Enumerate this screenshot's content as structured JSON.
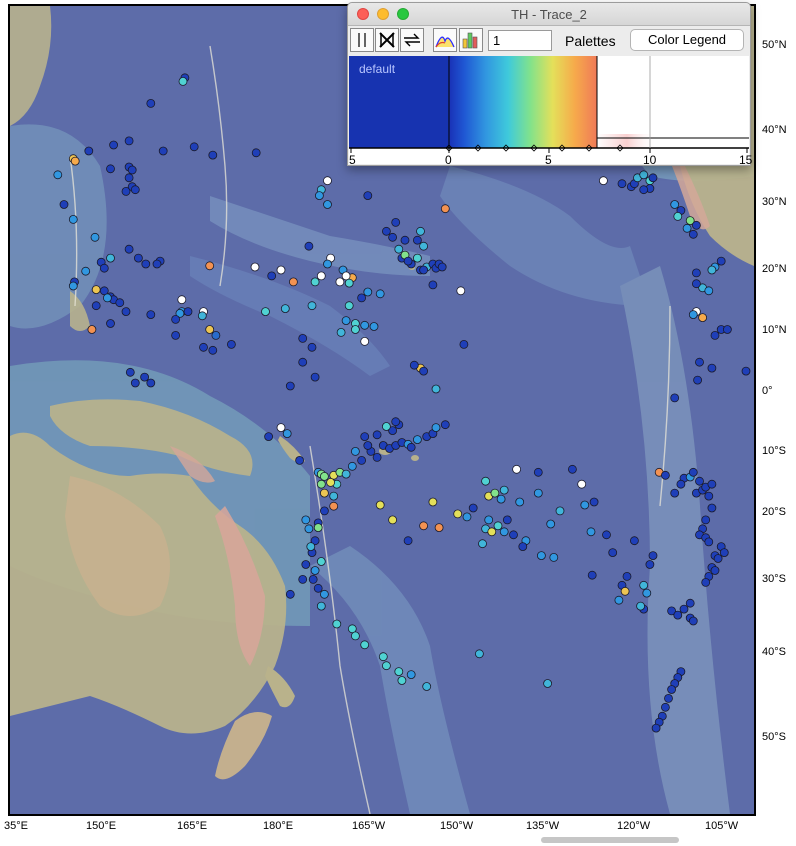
{
  "window": {
    "title": "TH - Trace_2",
    "level_value": "1",
    "palettes_label": "Palettes",
    "color_legend_label": "Color Legend",
    "palette_name": "default",
    "palette_ticks": [
      "5",
      "0",
      "5",
      "10",
      "15"
    ]
  },
  "map": {
    "lat_labels": [
      "50°N",
      "40°N",
      "30°N",
      "20°N",
      "10°N",
      "0°",
      "10°S",
      "20°S",
      "30°S",
      "40°S",
      "50°S"
    ],
    "lon_labels": [
      "35°E",
      "150°E",
      "165°E",
      "180°E",
      "165°W",
      "150°W",
      "135°W",
      "120°W",
      "105°W"
    ],
    "colors": {
      "ocean_deep": "#5d6ca9",
      "ocean_shelf": "#7fb6c2",
      "land": "#b9b28a",
      "land_high": "#d9a99a"
    }
  },
  "chart_data": {
    "type": "scatter",
    "xlim": [
      135,
      255
    ],
    "ylim": [
      -60,
      55
    ],
    "color_scale": {
      "min": -5,
      "max": 15
    },
    "points": [
      [
        164.5,
        51.8,
        0
      ],
      [
        164.2,
        51.2,
        4
      ],
      [
        159,
        47.5,
        0
      ],
      [
        146.5,
        38.2,
        8
      ],
      [
        146.8,
        37.8,
        9
      ],
      [
        144,
        35.5,
        2
      ],
      [
        149,
        39.5,
        0
      ],
      [
        153,
        40.5,
        0
      ],
      [
        155.5,
        41.2,
        0
      ],
      [
        161,
        39.5,
        0
      ],
      [
        166,
        40.2,
        0
      ],
      [
        169,
        38.8,
        0
      ],
      [
        176,
        39.2,
        0
      ],
      [
        152.5,
        36.5,
        0
      ],
      [
        155.5,
        36.8,
        0
      ],
      [
        156,
        36.3,
        0
      ],
      [
        155.5,
        35,
        0
      ],
      [
        156,
        33.5,
        0
      ],
      [
        156.5,
        33,
        0
      ],
      [
        155,
        32.7,
        0
      ],
      [
        145,
        30.5,
        0
      ],
      [
        146.5,
        28,
        2
      ],
      [
        150,
        25,
        2
      ],
      [
        155.5,
        23,
        0
      ],
      [
        157,
        21.5,
        0
      ],
      [
        160.5,
        21,
        0
      ],
      [
        160,
        20.5,
        0
      ],
      [
        158.2,
        20.5,
        0
      ],
      [
        151,
        20.8,
        0
      ],
      [
        152.5,
        21.5,
        3
      ],
      [
        151.5,
        19.8,
        0
      ],
      [
        148.5,
        19.3,
        2
      ],
      [
        146.7,
        17.5,
        0
      ],
      [
        146.5,
        16.8,
        2
      ],
      [
        150.2,
        16.2,
        8
      ],
      [
        151.5,
        16,
        0
      ],
      [
        152.5,
        15,
        0
      ],
      [
        153,
        14.5,
        0
      ],
      [
        154,
        14,
        0
      ],
      [
        152,
        14.8,
        2
      ],
      [
        150.2,
        13.5,
        0
      ],
      [
        155,
        12.5,
        0
      ],
      [
        159,
        12,
        0
      ],
      [
        164,
        12.5,
        2
      ],
      [
        163.7,
        12.2,
        2
      ],
      [
        165,
        12.5,
        0
      ],
      [
        163,
        11.2,
        0
      ],
      [
        167.5,
        12.5,
        15
      ],
      [
        167.3,
        11.8,
        3
      ],
      [
        168.5,
        9.5,
        8
      ],
      [
        169.5,
        8.5,
        1
      ],
      [
        172,
        7,
        0
      ],
      [
        163,
        8.5,
        0
      ],
      [
        167.5,
        6.5,
        0
      ],
      [
        169,
        6,
        0
      ],
      [
        149.5,
        9.5,
        10
      ],
      [
        152.5,
        10.5,
        0
      ],
      [
        155.7,
        2.3,
        0
      ],
      [
        158,
        1.5,
        0
      ],
      [
        159,
        0.5,
        0
      ],
      [
        156.5,
        0.5,
        0
      ],
      [
        164,
        14.5,
        15
      ],
      [
        168.5,
        20.2,
        10
      ],
      [
        177.5,
        12.5,
        4
      ],
      [
        180.7,
        13,
        3
      ],
      [
        185.5,
        17.5,
        4
      ],
      [
        186.5,
        18.5,
        15
      ],
      [
        182,
        17.5,
        10
      ],
      [
        178.5,
        18.5,
        0
      ],
      [
        180,
        19.5,
        15
      ],
      [
        175.8,
        20,
        15
      ],
      [
        184.5,
        23.5,
        0
      ],
      [
        188,
        21.5,
        15
      ],
      [
        187.5,
        20.5,
        2
      ],
      [
        190,
        19.5,
        2
      ],
      [
        191.5,
        18.2,
        9
      ],
      [
        189.5,
        17.5,
        15
      ],
      [
        190.5,
        18.5,
        15
      ],
      [
        191,
        17.3,
        4
      ],
      [
        194,
        15.8,
        2
      ],
      [
        193,
        14.8,
        0
      ],
      [
        196,
        15.5,
        2
      ],
      [
        191,
        13.5,
        4
      ],
      [
        190.5,
        11,
        2
      ],
      [
        192,
        10.5,
        4
      ],
      [
        193.5,
        10.2,
        2
      ],
      [
        192,
        9.5,
        4
      ],
      [
        195,
        10,
        2
      ],
      [
        193.5,
        7.5,
        15
      ],
      [
        189.7,
        9,
        3
      ],
      [
        185,
        13.5,
        3
      ],
      [
        183.5,
        8,
        0
      ],
      [
        185,
        6.5,
        0
      ],
      [
        183.5,
        4,
        0
      ],
      [
        181.5,
        0,
        0
      ],
      [
        185.5,
        1.5,
        0
      ],
      [
        187.5,
        30.5,
        2
      ],
      [
        186.5,
        33,
        3
      ],
      [
        186.2,
        32,
        2
      ],
      [
        187.5,
        34.5,
        15
      ],
      [
        194,
        32,
        0
      ],
      [
        197,
        26,
        0
      ],
      [
        198,
        25,
        0
      ],
      [
        200,
        24.5,
        0
      ],
      [
        199,
        23,
        3
      ],
      [
        199.5,
        21.5,
        0
      ],
      [
        202,
        21.5,
        4
      ],
      [
        201,
        20.5,
        0
      ],
      [
        202.5,
        19.5,
        0
      ],
      [
        203.5,
        20,
        3
      ],
      [
        204.5,
        20.5,
        0
      ],
      [
        205,
        19.8,
        0
      ],
      [
        205.5,
        20.5,
        0
      ],
      [
        206,
        20,
        0
      ],
      [
        200,
        22,
        5
      ],
      [
        200.5,
        21,
        0
      ],
      [
        203,
        19.5,
        0
      ],
      [
        202,
        24.5,
        0
      ],
      [
        203,
        23.5,
        3
      ],
      [
        202.5,
        26,
        3
      ],
      [
        204.5,
        17,
        0
      ],
      [
        209,
        16,
        15
      ],
      [
        209.5,
        7,
        0
      ],
      [
        202.5,
        3,
        8
      ],
      [
        201.5,
        3.5,
        0
      ],
      [
        203,
        2.5,
        0
      ],
      [
        205,
        -0.5,
        3
      ],
      [
        198.5,
        27.5,
        0
      ],
      [
        206.5,
        29.8,
        10
      ],
      [
        180,
        -7,
        15
      ],
      [
        181,
        -8,
        2
      ],
      [
        178,
        -8.5,
        0
      ],
      [
        183,
        -12.5,
        0
      ],
      [
        186,
        -14.5,
        2
      ],
      [
        186.5,
        -14.8,
        5
      ],
      [
        187,
        -15.2,
        5
      ],
      [
        188.5,
        -15,
        7
      ],
      [
        189.5,
        -14.5,
        5
      ],
      [
        190.5,
        -14.8,
        3
      ],
      [
        191.5,
        -13.5,
        2
      ],
      [
        193,
        -12.5,
        0
      ],
      [
        194.5,
        -11,
        0
      ],
      [
        193.5,
        -8.5,
        0
      ],
      [
        195.5,
        -8.2,
        0
      ],
      [
        196.5,
        -10,
        0
      ],
      [
        197.5,
        -10.5,
        0
      ],
      [
        198.5,
        -10,
        0
      ],
      [
        199.5,
        -9.5,
        0
      ],
      [
        200.5,
        -9.8,
        2
      ],
      [
        201,
        -10.3,
        0
      ],
      [
        202,
        -9,
        2
      ],
      [
        203.5,
        -8.5,
        0
      ],
      [
        204.5,
        -8,
        0
      ],
      [
        205,
        -7,
        2
      ],
      [
        206.5,
        -6.5,
        0
      ],
      [
        199,
        -6.5,
        0
      ],
      [
        198.5,
        -6,
        0
      ],
      [
        198,
        -7.5,
        0
      ],
      [
        197,
        -6.8,
        4
      ],
      [
        194,
        -10,
        0
      ],
      [
        195.5,
        -12,
        0
      ],
      [
        192,
        -11,
        2
      ],
      [
        186.5,
        -16.5,
        5
      ],
      [
        187,
        -18,
        8
      ],
      [
        189,
        -16.5,
        4
      ],
      [
        188.5,
        -18.5,
        3
      ],
      [
        187,
        -21,
        0
      ],
      [
        186,
        -23,
        0
      ],
      [
        185.5,
        -26,
        0
      ],
      [
        185,
        -28,
        0
      ],
      [
        186.5,
        -29.5,
        4
      ],
      [
        185.5,
        -31,
        2
      ],
      [
        185.2,
        -32.5,
        0
      ],
      [
        186,
        -34,
        0
      ],
      [
        187,
        -35,
        2
      ],
      [
        186.5,
        -37,
        3
      ],
      [
        189,
        -40,
        4
      ],
      [
        191.5,
        -40.8,
        4
      ],
      [
        192,
        -42,
        4
      ],
      [
        193.5,
        -43.5,
        4
      ],
      [
        196.5,
        -45.5,
        4
      ],
      [
        197,
        -47,
        4
      ],
      [
        199,
        -48,
        4
      ],
      [
        199.5,
        -49.5,
        4
      ],
      [
        201,
        -48.5,
        2
      ],
      [
        203.5,
        -50.5,
        3
      ],
      [
        184.5,
        -24,
        2
      ],
      [
        184,
        -22.5,
        2
      ],
      [
        184.8,
        -27,
        3
      ],
      [
        184,
        -30,
        0
      ],
      [
        183.5,
        -32.5,
        0
      ],
      [
        181.5,
        -35,
        0
      ],
      [
        186,
        -23.8,
        5
      ],
      [
        188.5,
        -20.2,
        10
      ],
      [
        188,
        -16.2,
        7
      ],
      [
        196,
        -20,
        7
      ],
      [
        198,
        -22.5,
        7
      ],
      [
        200.5,
        -26,
        0
      ],
      [
        203,
        -23.5,
        10
      ],
      [
        205.5,
        -23.8,
        10
      ],
      [
        204.5,
        -19.5,
        7
      ],
      [
        210,
        -22,
        2
      ],
      [
        208.5,
        -21.5,
        7
      ],
      [
        211,
        -20.5,
        0
      ],
      [
        213.5,
        -22.5,
        2
      ],
      [
        213,
        -24,
        3
      ],
      [
        214,
        -24.5,
        7
      ],
      [
        215,
        -23.5,
        4
      ],
      [
        216,
        -24.5,
        2
      ],
      [
        216.5,
        -22.5,
        0
      ],
      [
        217.5,
        -25,
        0
      ],
      [
        219.5,
        -26,
        2
      ],
      [
        219,
        -27,
        0
      ],
      [
        222,
        -28.5,
        2
      ],
      [
        224,
        -28.8,
        2
      ],
      [
        212.5,
        -26.5,
        3
      ],
      [
        213.5,
        -18.5,
        7
      ],
      [
        214.5,
        -18,
        5
      ],
      [
        216,
        -17.5,
        3
      ],
      [
        215.5,
        -19,
        2
      ],
      [
        218.5,
        -19.5,
        2
      ],
      [
        221.5,
        -18,
        2
      ],
      [
        213,
        -16,
        4
      ],
      [
        218,
        -14,
        15
      ],
      [
        221.5,
        -14.5,
        0
      ],
      [
        227,
        -14,
        0
      ],
      [
        228.5,
        -16.5,
        15
      ],
      [
        225,
        -21,
        3
      ],
      [
        229,
        -20,
        2
      ],
      [
        230.5,
        -19.5,
        0
      ],
      [
        223.5,
        -23.2,
        2
      ],
      [
        230,
        -24.5,
        2
      ],
      [
        232.5,
        -25,
        0
      ],
      [
        237,
        -26,
        0
      ],
      [
        233.5,
        -28,
        0
      ],
      [
        240,
        -28.5,
        0
      ],
      [
        239.5,
        -30,
        0
      ],
      [
        230.2,
        -31.8,
        0
      ],
      [
        235.8,
        -32,
        0
      ],
      [
        235,
        -33.5,
        0
      ],
      [
        235.5,
        -34.5,
        8
      ],
      [
        238.5,
        -33.5,
        3
      ],
      [
        239,
        -34.8,
        2
      ],
      [
        234.5,
        -36,
        2
      ],
      [
        238.5,
        -37.5,
        0
      ],
      [
        238,
        -37,
        3
      ],
      [
        246,
        -36.5,
        0
      ],
      [
        245,
        -37.5,
        0
      ],
      [
        243,
        -37.8,
        0
      ],
      [
        244,
        -38.5,
        0
      ],
      [
        246,
        -39,
        0
      ],
      [
        246.5,
        -39.5,
        0
      ],
      [
        241,
        -14.5,
        10
      ],
      [
        242,
        -15,
        0
      ],
      [
        245,
        -15.5,
        0
      ],
      [
        244.5,
        -16.5,
        0
      ],
      [
        243.5,
        -18,
        0
      ],
      [
        246,
        -15.3,
        2
      ],
      [
        246.5,
        -14.5,
        0
      ],
      [
        247.5,
        -16,
        0
      ],
      [
        247,
        -18,
        0
      ],
      [
        248,
        -17.5,
        0
      ],
      [
        248.5,
        -17,
        0
      ],
      [
        249.5,
        -16.5,
        0
      ],
      [
        249,
        -18.5,
        0
      ],
      [
        249.5,
        -20.5,
        0
      ],
      [
        248.5,
        -22.5,
        0
      ],
      [
        248,
        -24,
        0
      ],
      [
        247.5,
        -25,
        0
      ],
      [
        248.5,
        -25.5,
        0
      ],
      [
        249,
        -26.2,
        0
      ],
      [
        251,
        -27,
        0
      ],
      [
        251.5,
        -28,
        0
      ],
      [
        250,
        -28.5,
        0
      ],
      [
        250.5,
        -29,
        0
      ],
      [
        249.5,
        -30.5,
        0
      ],
      [
        250,
        -31,
        0
      ],
      [
        249,
        -32,
        0
      ],
      [
        248.5,
        -33,
        0
      ],
      [
        243.5,
        -2,
        0
      ],
      [
        251,
        9.5,
        0
      ],
      [
        252,
        9.5,
        0
      ],
      [
        250,
        8.5,
        0
      ],
      [
        247,
        12.5,
        15
      ],
      [
        248,
        11.5,
        9
      ],
      [
        246.5,
        12,
        2
      ],
      [
        247.5,
        4,
        0
      ],
      [
        247.2,
        1,
        0
      ],
      [
        249.5,
        3,
        0
      ],
      [
        255,
        2.5,
        0
      ],
      [
        251,
        21,
        0
      ],
      [
        250,
        20,
        2
      ],
      [
        249.5,
        19.5,
        3
      ],
      [
        247,
        19,
        0
      ],
      [
        248,
        16.5,
        3
      ],
      [
        247,
        17.2,
        0
      ],
      [
        249,
        16,
        2
      ],
      [
        232,
        34.5,
        15
      ],
      [
        235,
        34,
        0
      ],
      [
        236.5,
        33.5,
        0
      ],
      [
        237,
        34,
        0
      ],
      [
        237.5,
        35,
        3
      ],
      [
        238.5,
        35.5,
        3
      ],
      [
        239.5,
        34.5,
        4
      ],
      [
        240,
        35,
        0
      ],
      [
        239.5,
        33.2,
        0
      ],
      [
        238.5,
        33,
        0
      ],
      [
        243.5,
        30.5,
        2
      ],
      [
        244.5,
        29.5,
        0
      ],
      [
        244,
        28.5,
        4
      ],
      [
        245.5,
        26.5,
        2
      ],
      [
        246.5,
        25.5,
        0
      ],
      [
        246,
        27.8,
        5
      ],
      [
        247,
        27,
        0
      ],
      [
        244.5,
        -48,
        0
      ],
      [
        244,
        -49,
        0
      ],
      [
        243.5,
        -50,
        0
      ],
      [
        243,
        -51,
        0
      ],
      [
        242.5,
        -52.5,
        0
      ],
      [
        242,
        -54,
        0
      ],
      [
        241.5,
        -55.5,
        0
      ],
      [
        241,
        -56.5,
        0
      ],
      [
        240.5,
        -57.5,
        0
      ],
      [
        223,
        -50,
        3
      ],
      [
        212,
        -45,
        3
      ]
    ]
  }
}
